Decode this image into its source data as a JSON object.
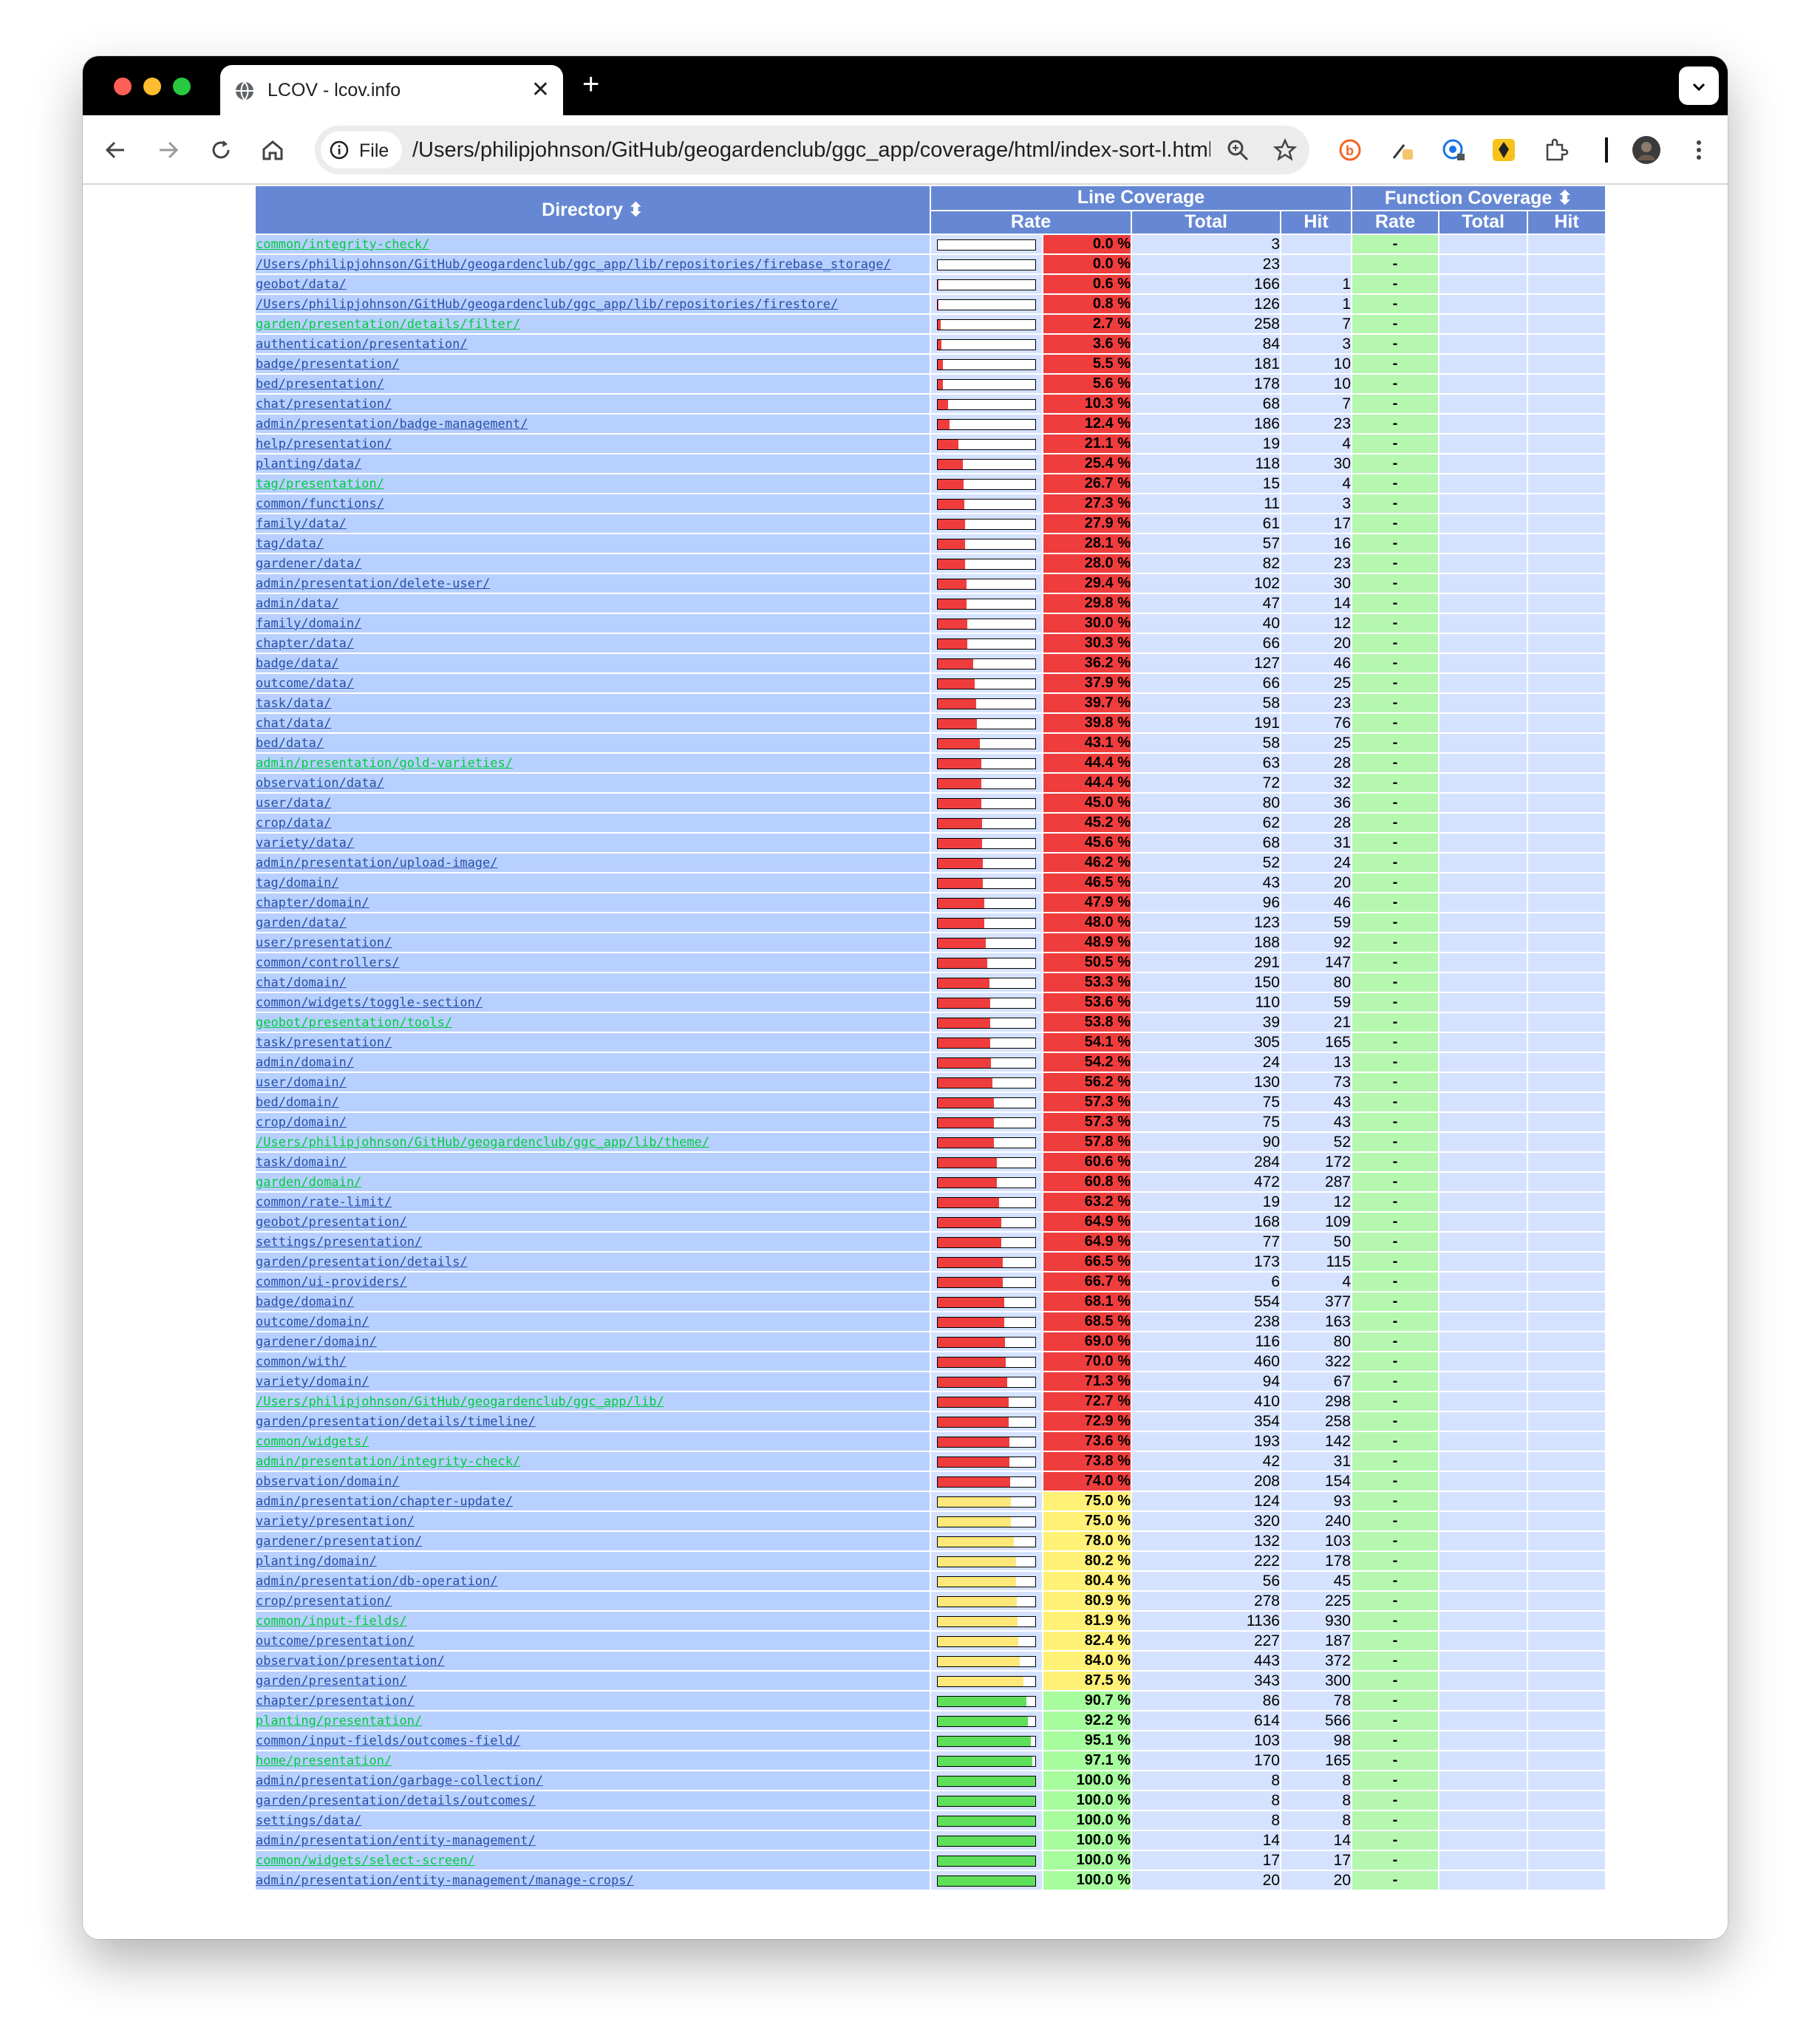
{
  "browser": {
    "tab_title": "LCOV - lcov.info",
    "chip_label": "File",
    "url": "/Users/philipjohnson/GitHub/geogardenclub/ggc_app/coverage/html/index-sort-l.html",
    "colors": {
      "low": "#ef3d3d",
      "medium": "#fff176",
      "high": "#a7fc9d"
    }
  },
  "table": {
    "headers": {
      "directory": "Directory ⬍",
      "line_coverage": "Line Coverage",
      "function_coverage": "Function Coverage ⬍",
      "rate": "Rate",
      "total": "Total",
      "hit": "Hit"
    },
    "rows": [
      {
        "dir": "common/integrity-check/",
        "rate": "0.0 %",
        "pct": 0.0,
        "total": "3",
        "hit": "",
        "frate": "-",
        "green": true
      },
      {
        "dir": "/Users/philipjohnson/GitHub/geogardenclub/ggc_app/lib/repositories/firebase_storage/",
        "rate": "0.0 %",
        "pct": 0.0,
        "total": "23",
        "hit": "",
        "frate": "-",
        "green": false
      },
      {
        "dir": "geobot/data/",
        "rate": "0.6 %",
        "pct": 0.6,
        "total": "166",
        "hit": "1",
        "frate": "-",
        "green": false
      },
      {
        "dir": "/Users/philipjohnson/GitHub/geogardenclub/ggc_app/lib/repositories/firestore/",
        "rate": "0.8 %",
        "pct": 0.8,
        "total": "126",
        "hit": "1",
        "frate": "-",
        "green": false
      },
      {
        "dir": "garden/presentation/details/filter/",
        "rate": "2.7 %",
        "pct": 2.7,
        "total": "258",
        "hit": "7",
        "frate": "-",
        "green": true
      },
      {
        "dir": "authentication/presentation/",
        "rate": "3.6 %",
        "pct": 3.6,
        "total": "84",
        "hit": "3",
        "frate": "-",
        "green": false
      },
      {
        "dir": "badge/presentation/",
        "rate": "5.5 %",
        "pct": 5.5,
        "total": "181",
        "hit": "10",
        "frate": "-",
        "green": false
      },
      {
        "dir": "bed/presentation/",
        "rate": "5.6 %",
        "pct": 5.6,
        "total": "178",
        "hit": "10",
        "frate": "-",
        "green": false
      },
      {
        "dir": "chat/presentation/",
        "rate": "10.3 %",
        "pct": 10.3,
        "total": "68",
        "hit": "7",
        "frate": "-",
        "green": false
      },
      {
        "dir": "admin/presentation/badge-management/",
        "rate": "12.4 %",
        "pct": 12.4,
        "total": "186",
        "hit": "23",
        "frate": "-",
        "green": false
      },
      {
        "dir": "help/presentation/",
        "rate": "21.1 %",
        "pct": 21.1,
        "total": "19",
        "hit": "4",
        "frate": "-",
        "green": false
      },
      {
        "dir": "planting/data/",
        "rate": "25.4 %",
        "pct": 25.4,
        "total": "118",
        "hit": "30",
        "frate": "-",
        "green": false
      },
      {
        "dir": "tag/presentation/",
        "rate": "26.7 %",
        "pct": 26.7,
        "total": "15",
        "hit": "4",
        "frate": "-",
        "green": true
      },
      {
        "dir": "common/functions/",
        "rate": "27.3 %",
        "pct": 27.3,
        "total": "11",
        "hit": "3",
        "frate": "-",
        "green": false
      },
      {
        "dir": "family/data/",
        "rate": "27.9 %",
        "pct": 27.9,
        "total": "61",
        "hit": "17",
        "frate": "-",
        "green": false
      },
      {
        "dir": "tag/data/",
        "rate": "28.1 %",
        "pct": 28.1,
        "total": "57",
        "hit": "16",
        "frate": "-",
        "green": false
      },
      {
        "dir": "gardener/data/",
        "rate": "28.0 %",
        "pct": 28.0,
        "total": "82",
        "hit": "23",
        "frate": "-",
        "green": false
      },
      {
        "dir": "admin/presentation/delete-user/",
        "rate": "29.4 %",
        "pct": 29.4,
        "total": "102",
        "hit": "30",
        "frate": "-",
        "green": false
      },
      {
        "dir": "admin/data/",
        "rate": "29.8 %",
        "pct": 29.8,
        "total": "47",
        "hit": "14",
        "frate": "-",
        "green": false
      },
      {
        "dir": "family/domain/",
        "rate": "30.0 %",
        "pct": 30.0,
        "total": "40",
        "hit": "12",
        "frate": "-",
        "green": false
      },
      {
        "dir": "chapter/data/",
        "rate": "30.3 %",
        "pct": 30.3,
        "total": "66",
        "hit": "20",
        "frate": "-",
        "green": false
      },
      {
        "dir": "badge/data/",
        "rate": "36.2 %",
        "pct": 36.2,
        "total": "127",
        "hit": "46",
        "frate": "-",
        "green": false
      },
      {
        "dir": "outcome/data/",
        "rate": "37.9 %",
        "pct": 37.9,
        "total": "66",
        "hit": "25",
        "frate": "-",
        "green": false
      },
      {
        "dir": "task/data/",
        "rate": "39.7 %",
        "pct": 39.7,
        "total": "58",
        "hit": "23",
        "frate": "-",
        "green": false
      },
      {
        "dir": "chat/data/",
        "rate": "39.8 %",
        "pct": 39.8,
        "total": "191",
        "hit": "76",
        "frate": "-",
        "green": false
      },
      {
        "dir": "bed/data/",
        "rate": "43.1 %",
        "pct": 43.1,
        "total": "58",
        "hit": "25",
        "frate": "-",
        "green": false
      },
      {
        "dir": "admin/presentation/gold-varieties/",
        "rate": "44.4 %",
        "pct": 44.4,
        "total": "63",
        "hit": "28",
        "frate": "-",
        "green": true
      },
      {
        "dir": "observation/data/",
        "rate": "44.4 %",
        "pct": 44.4,
        "total": "72",
        "hit": "32",
        "frate": "-",
        "green": false
      },
      {
        "dir": "user/data/",
        "rate": "45.0 %",
        "pct": 45.0,
        "total": "80",
        "hit": "36",
        "frate": "-",
        "green": false
      },
      {
        "dir": "crop/data/",
        "rate": "45.2 %",
        "pct": 45.2,
        "total": "62",
        "hit": "28",
        "frate": "-",
        "green": false
      },
      {
        "dir": "variety/data/",
        "rate": "45.6 %",
        "pct": 45.6,
        "total": "68",
        "hit": "31",
        "frate": "-",
        "green": false
      },
      {
        "dir": "admin/presentation/upload-image/",
        "rate": "46.2 %",
        "pct": 46.2,
        "total": "52",
        "hit": "24",
        "frate": "-",
        "green": false
      },
      {
        "dir": "tag/domain/",
        "rate": "46.5 %",
        "pct": 46.5,
        "total": "43",
        "hit": "20",
        "frate": "-",
        "green": false
      },
      {
        "dir": "chapter/domain/",
        "rate": "47.9 %",
        "pct": 47.9,
        "total": "96",
        "hit": "46",
        "frate": "-",
        "green": false
      },
      {
        "dir": "garden/data/",
        "rate": "48.0 %",
        "pct": 48.0,
        "total": "123",
        "hit": "59",
        "frate": "-",
        "green": false
      },
      {
        "dir": "user/presentation/",
        "rate": "48.9 %",
        "pct": 48.9,
        "total": "188",
        "hit": "92",
        "frate": "-",
        "green": false
      },
      {
        "dir": "common/controllers/",
        "rate": "50.5 %",
        "pct": 50.5,
        "total": "291",
        "hit": "147",
        "frate": "-",
        "green": false
      },
      {
        "dir": "chat/domain/",
        "rate": "53.3 %",
        "pct": 53.3,
        "total": "150",
        "hit": "80",
        "frate": "-",
        "green": false
      },
      {
        "dir": "common/widgets/toggle-section/",
        "rate": "53.6 %",
        "pct": 53.6,
        "total": "110",
        "hit": "59",
        "frate": "-",
        "green": false
      },
      {
        "dir": "geobot/presentation/tools/",
        "rate": "53.8 %",
        "pct": 53.8,
        "total": "39",
        "hit": "21",
        "frate": "-",
        "green": true
      },
      {
        "dir": "task/presentation/",
        "rate": "54.1 %",
        "pct": 54.1,
        "total": "305",
        "hit": "165",
        "frate": "-",
        "green": false
      },
      {
        "dir": "admin/domain/",
        "rate": "54.2 %",
        "pct": 54.2,
        "total": "24",
        "hit": "13",
        "frate": "-",
        "green": false
      },
      {
        "dir": "user/domain/",
        "rate": "56.2 %",
        "pct": 56.2,
        "total": "130",
        "hit": "73",
        "frate": "-",
        "green": false
      },
      {
        "dir": "bed/domain/",
        "rate": "57.3 %",
        "pct": 57.3,
        "total": "75",
        "hit": "43",
        "frate": "-",
        "green": false
      },
      {
        "dir": "crop/domain/",
        "rate": "57.3 %",
        "pct": 57.3,
        "total": "75",
        "hit": "43",
        "frate": "-",
        "green": false
      },
      {
        "dir": "/Users/philipjohnson/GitHub/geogardenclub/ggc_app/lib/theme/",
        "rate": "57.8 %",
        "pct": 57.8,
        "total": "90",
        "hit": "52",
        "frate": "-",
        "green": true
      },
      {
        "dir": "task/domain/",
        "rate": "60.6 %",
        "pct": 60.6,
        "total": "284",
        "hit": "172",
        "frate": "-",
        "green": false
      },
      {
        "dir": "garden/domain/",
        "rate": "60.8 %",
        "pct": 60.8,
        "total": "472",
        "hit": "287",
        "frate": "-",
        "green": true
      },
      {
        "dir": "common/rate-limit/",
        "rate": "63.2 %",
        "pct": 63.2,
        "total": "19",
        "hit": "12",
        "frate": "-",
        "green": false
      },
      {
        "dir": "geobot/presentation/",
        "rate": "64.9 %",
        "pct": 64.9,
        "total": "168",
        "hit": "109",
        "frate": "-",
        "green": false
      },
      {
        "dir": "settings/presentation/",
        "rate": "64.9 %",
        "pct": 64.9,
        "total": "77",
        "hit": "50",
        "frate": "-",
        "green": false
      },
      {
        "dir": "garden/presentation/details/",
        "rate": "66.5 %",
        "pct": 66.5,
        "total": "173",
        "hit": "115",
        "frate": "-",
        "green": false
      },
      {
        "dir": "common/ui-providers/",
        "rate": "66.7 %",
        "pct": 66.7,
        "total": "6",
        "hit": "4",
        "frate": "-",
        "green": false
      },
      {
        "dir": "badge/domain/",
        "rate": "68.1 %",
        "pct": 68.1,
        "total": "554",
        "hit": "377",
        "frate": "-",
        "green": false
      },
      {
        "dir": "outcome/domain/",
        "rate": "68.5 %",
        "pct": 68.5,
        "total": "238",
        "hit": "163",
        "frate": "-",
        "green": false
      },
      {
        "dir": "gardener/domain/",
        "rate": "69.0 %",
        "pct": 69.0,
        "total": "116",
        "hit": "80",
        "frate": "-",
        "green": false
      },
      {
        "dir": "common/with/",
        "rate": "70.0 %",
        "pct": 70.0,
        "total": "460",
        "hit": "322",
        "frate": "-",
        "green": false
      },
      {
        "dir": "variety/domain/",
        "rate": "71.3 %",
        "pct": 71.3,
        "total": "94",
        "hit": "67",
        "frate": "-",
        "green": false
      },
      {
        "dir": "/Users/philipjohnson/GitHub/geogardenclub/ggc_app/lib/",
        "rate": "72.7 %",
        "pct": 72.7,
        "total": "410",
        "hit": "298",
        "frate": "-",
        "green": true
      },
      {
        "dir": "garden/presentation/details/timeline/",
        "rate": "72.9 %",
        "pct": 72.9,
        "total": "354",
        "hit": "258",
        "frate": "-",
        "green": false
      },
      {
        "dir": "common/widgets/",
        "rate": "73.6 %",
        "pct": 73.6,
        "total": "193",
        "hit": "142",
        "frate": "-",
        "green": true
      },
      {
        "dir": "admin/presentation/integrity-check/",
        "rate": "73.8 %",
        "pct": 73.8,
        "total": "42",
        "hit": "31",
        "frate": "-",
        "green": true
      },
      {
        "dir": "observation/domain/",
        "rate": "74.0 %",
        "pct": 74.0,
        "total": "208",
        "hit": "154",
        "frate": "-",
        "green": false
      },
      {
        "dir": "admin/presentation/chapter-update/",
        "rate": "75.0 %",
        "pct": 75.0,
        "total": "124",
        "hit": "93",
        "frate": "-",
        "green": false
      },
      {
        "dir": "variety/presentation/",
        "rate": "75.0 %",
        "pct": 75.0,
        "total": "320",
        "hit": "240",
        "frate": "-",
        "green": false
      },
      {
        "dir": "gardener/presentation/",
        "rate": "78.0 %",
        "pct": 78.0,
        "total": "132",
        "hit": "103",
        "frate": "-",
        "green": false
      },
      {
        "dir": "planting/domain/",
        "rate": "80.2 %",
        "pct": 80.2,
        "total": "222",
        "hit": "178",
        "frate": "-",
        "green": false
      },
      {
        "dir": "admin/presentation/db-operation/",
        "rate": "80.4 %",
        "pct": 80.4,
        "total": "56",
        "hit": "45",
        "frate": "-",
        "green": false
      },
      {
        "dir": "crop/presentation/",
        "rate": "80.9 %",
        "pct": 80.9,
        "total": "278",
        "hit": "225",
        "frate": "-",
        "green": false
      },
      {
        "dir": "common/input-fields/",
        "rate": "81.9 %",
        "pct": 81.9,
        "total": "1136",
        "hit": "930",
        "frate": "-",
        "green": true
      },
      {
        "dir": "outcome/presentation/",
        "rate": "82.4 %",
        "pct": 82.4,
        "total": "227",
        "hit": "187",
        "frate": "-",
        "green": false
      },
      {
        "dir": "observation/presentation/",
        "rate": "84.0 %",
        "pct": 84.0,
        "total": "443",
        "hit": "372",
        "frate": "-",
        "green": false
      },
      {
        "dir": "garden/presentation/",
        "rate": "87.5 %",
        "pct": 87.5,
        "total": "343",
        "hit": "300",
        "frate": "-",
        "green": false
      },
      {
        "dir": "chapter/presentation/",
        "rate": "90.7 %",
        "pct": 90.7,
        "total": "86",
        "hit": "78",
        "frate": "-",
        "green": false
      },
      {
        "dir": "planting/presentation/",
        "rate": "92.2 %",
        "pct": 92.2,
        "total": "614",
        "hit": "566",
        "frate": "-",
        "green": true
      },
      {
        "dir": "common/input-fields/outcomes-field/",
        "rate": "95.1 %",
        "pct": 95.1,
        "total": "103",
        "hit": "98",
        "frate": "-",
        "green": false
      },
      {
        "dir": "home/presentation/",
        "rate": "97.1 %",
        "pct": 97.1,
        "total": "170",
        "hit": "165",
        "frate": "-",
        "green": true
      },
      {
        "dir": "admin/presentation/garbage-collection/",
        "rate": "100.0 %",
        "pct": 100.0,
        "total": "8",
        "hit": "8",
        "frate": "-",
        "green": false
      },
      {
        "dir": "garden/presentation/details/outcomes/",
        "rate": "100.0 %",
        "pct": 100.0,
        "total": "8",
        "hit": "8",
        "frate": "-",
        "green": false
      },
      {
        "dir": "settings/data/",
        "rate": "100.0 %",
        "pct": 100.0,
        "total": "8",
        "hit": "8",
        "frate": "-",
        "green": false
      },
      {
        "dir": "admin/presentation/entity-management/",
        "rate": "100.0 %",
        "pct": 100.0,
        "total": "14",
        "hit": "14",
        "frate": "-",
        "green": false
      },
      {
        "dir": "common/widgets/select-screen/",
        "rate": "100.0 %",
        "pct": 100.0,
        "total": "17",
        "hit": "17",
        "frate": "-",
        "green": true
      },
      {
        "dir": "admin/presentation/entity-management/manage-crops/",
        "rate": "100.0 %",
        "pct": 100.0,
        "total": "20",
        "hit": "20",
        "frate": "-",
        "green": false
      }
    ]
  }
}
